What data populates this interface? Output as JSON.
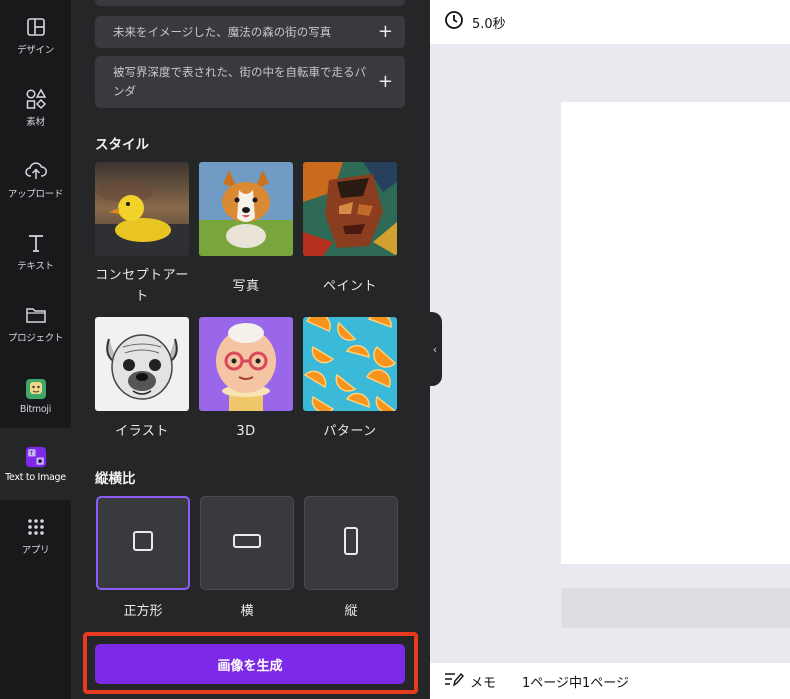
{
  "rail": {
    "items": [
      {
        "label": "デザイン"
      },
      {
        "label": "素材"
      },
      {
        "label": "アップロード"
      },
      {
        "label": "テキスト"
      },
      {
        "label": "プロジェクト"
      },
      {
        "label": "Bitmoji"
      },
      {
        "label": "Text to Image"
      },
      {
        "label": "アプリ"
      }
    ]
  },
  "prompts": [
    {
      "text": "未来をイメージした、魔法の森の街の写真"
    },
    {
      "text": "被写界深度で表された、街の中を自転車で走るパンダ"
    }
  ],
  "style": {
    "title": "スタイル",
    "items": [
      {
        "label": "コンセプトアート"
      },
      {
        "label": "写真"
      },
      {
        "label": "ペイント"
      },
      {
        "label": "イラスト"
      },
      {
        "label": "3D"
      },
      {
        "label": "パターン"
      }
    ]
  },
  "aspect": {
    "title": "縦横比",
    "items": [
      {
        "label": "正方形"
      },
      {
        "label": "横"
      },
      {
        "label": "縦"
      }
    ]
  },
  "generate_button": "画像を生成",
  "topbar": {
    "time": "5.0秒"
  },
  "bottombar": {
    "memo": "メモ",
    "page_info": "1ページ中1ページ"
  },
  "colors": {
    "accent": "#7d2ae8",
    "selected_border": "#8b5cf6",
    "highlight_outline": "#e53a1e"
  }
}
